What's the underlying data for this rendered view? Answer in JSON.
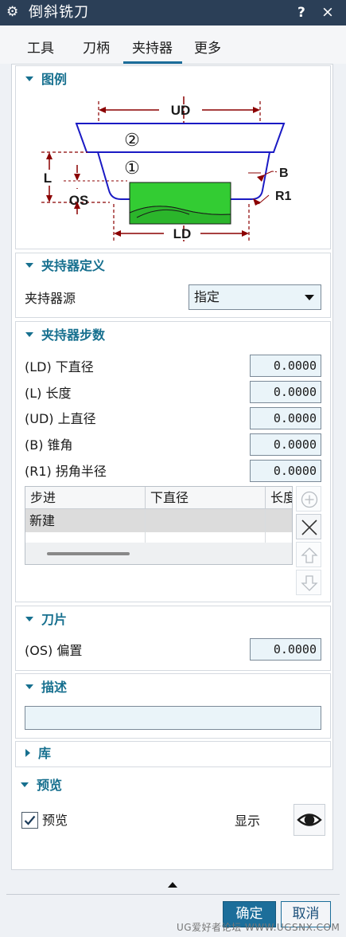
{
  "window": {
    "title": "倒斜铣刀",
    "help_label": "?",
    "close_label": "×"
  },
  "tabs": [
    {
      "label": "工具"
    },
    {
      "label": "刀柄"
    },
    {
      "label": "夹持器",
      "active": true
    },
    {
      "label": "更多"
    }
  ],
  "sections": {
    "legend": {
      "title": "图例",
      "diagram_labels": {
        "ud": "UD",
        "ld": "LD",
        "l": "L",
        "os": "OS",
        "b": "B",
        "r1": "R1",
        "step1": "①",
        "step2": "②"
      }
    },
    "holder_def": {
      "title": "夹持器定义",
      "source_label": "夹持器源",
      "source_value": "指定"
    },
    "holder_steps": {
      "title": "夹持器步数",
      "fields": [
        {
          "label": "(LD) 下直径",
          "value": "0.0000"
        },
        {
          "label": "(L) 长度",
          "value": "0.0000"
        },
        {
          "label": "(UD) 上直径",
          "value": "0.0000"
        },
        {
          "label": "(B) 锥角",
          "value": "0.0000"
        },
        {
          "label": "(R1) 拐角半径",
          "value": "0.0000"
        }
      ],
      "table": {
        "columns": [
          "步进",
          "下直径",
          "长度"
        ],
        "rows": [
          [
            "新建",
            "",
            ""
          ]
        ]
      }
    },
    "insert": {
      "title": "刀片",
      "offset_label": "(OS) 偏置",
      "offset_value": "0.0000"
    },
    "description": {
      "title": "描述",
      "value": ""
    },
    "library": {
      "title": "库"
    },
    "preview": {
      "title": "预览",
      "checkbox_label": "预览",
      "checked": true,
      "show_label": "显示"
    }
  },
  "buttons": {
    "ok": "确定",
    "cancel": "取消"
  },
  "watermark": "UG爱好者论坛 WWW.UGSNX.COM",
  "colors": {
    "titlebar": "#2b3f57",
    "accent": "#1c6e9a",
    "section_header": "#17708f",
    "holder_green": "#33cc33",
    "dimension_red": "#8b0000"
  }
}
